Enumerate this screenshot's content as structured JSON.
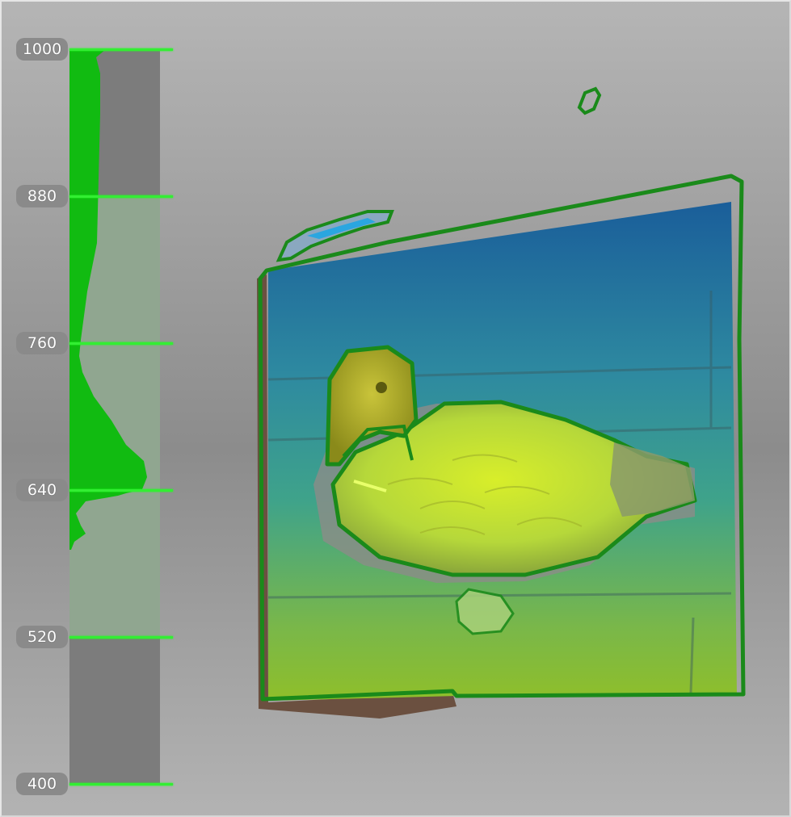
{
  "depth_slider": {
    "ticks": [
      "1000",
      "880",
      "760",
      "640",
      "520",
      "400"
    ],
    "tick_values": [
      1000,
      880,
      760,
      640,
      520,
      400
    ],
    "min": 400,
    "max": 1000,
    "selected_range": [
      520,
      880
    ],
    "accent_color": "#33ee33",
    "histogram_color": "#11bb11"
  },
  "scene": {
    "subject_icon": "duck-decoy-point-cloud",
    "outline_color": "#1a8a1a"
  }
}
